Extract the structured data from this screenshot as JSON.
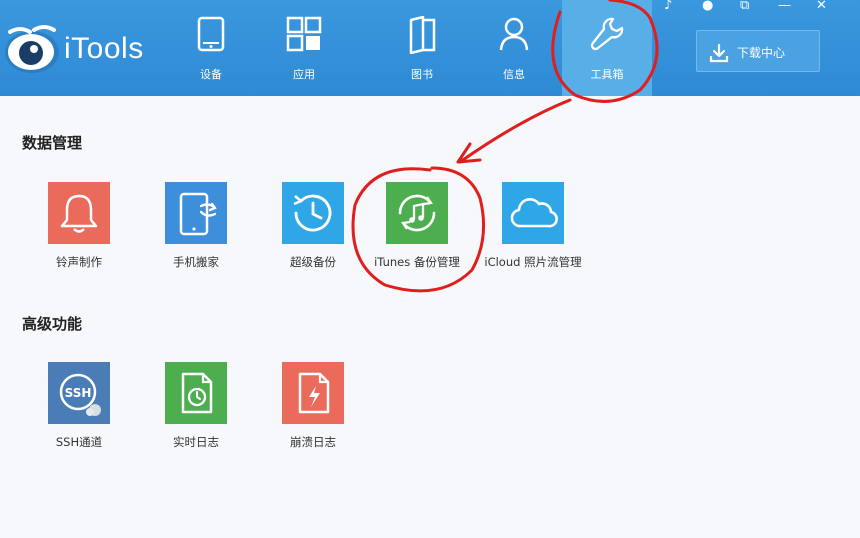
{
  "app": {
    "title": "iTools",
    "accent": "#2f8ad4"
  },
  "window_controls": [
    "♪",
    "●",
    "⧉",
    "—",
    "✕"
  ],
  "nav": [
    {
      "label": "设备",
      "icon": "device-icon"
    },
    {
      "label": "应用",
      "icon": "apps-icon"
    },
    {
      "label": "图书",
      "icon": "books-icon"
    },
    {
      "label": "信息",
      "icon": "contacts-icon"
    },
    {
      "label": "工具箱",
      "icon": "toolbox-icon",
      "active": true
    }
  ],
  "download_center": {
    "label": "下载中心",
    "icon": "download-icon"
  },
  "sections": [
    {
      "title": "数据管理",
      "tiles": [
        {
          "label": "铃声制作",
          "icon": "bell-icon",
          "color": "#ea6b5c"
        },
        {
          "label": "手机搬家",
          "icon": "phone-transfer-icon",
          "color": "#3d8fdc"
        },
        {
          "label": "超级备份",
          "icon": "backup-clock-icon",
          "color": "#2fa6e6"
        },
        {
          "label": "iTunes 备份管理",
          "icon": "itunes-backup-icon",
          "color": "#4cae4f"
        },
        {
          "label": "iCloud 照片流管理",
          "icon": "icloud-icon",
          "color": "#2fa6e6"
        }
      ]
    },
    {
      "title": "高级功能",
      "tiles": [
        {
          "label": "SSH通道",
          "icon": "ssh-icon",
          "color": "#4a7db5"
        },
        {
          "label": "实时日志",
          "icon": "realtime-log-icon",
          "color": "#4cae4f"
        },
        {
          "label": "崩溃日志",
          "icon": "crash-log-icon",
          "color": "#ea6b5c"
        }
      ]
    }
  ],
  "annotation_color": "#e01e1e"
}
